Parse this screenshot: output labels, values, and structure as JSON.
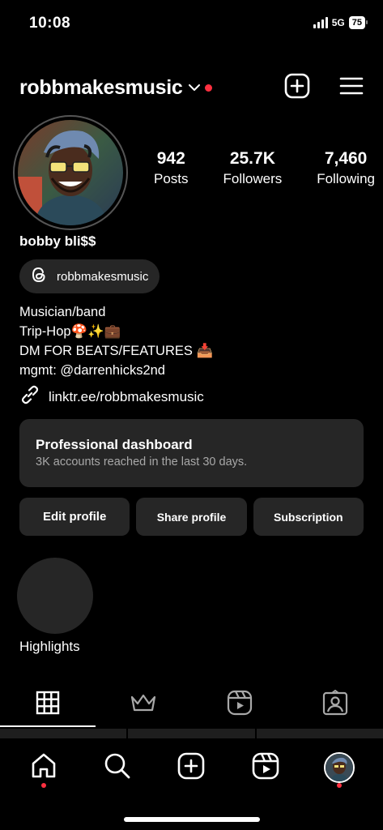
{
  "status": {
    "time": "10:08",
    "network": "5G",
    "battery": "75"
  },
  "header": {
    "username": "robbmakesmusic"
  },
  "stats": [
    {
      "value": "942",
      "label": "Posts"
    },
    {
      "value": "25.7K",
      "label": "Followers"
    },
    {
      "value": "7,460",
      "label": "Following"
    }
  ],
  "profile": {
    "display_name": "bobby bli$$",
    "threads_handle": "robbmakesmusic",
    "bio": [
      "Musician/band",
      "Trip-Hop🍄✨💼",
      "DM FOR BEATS/FEATURES 📥",
      "mgmt: @darrenhicks2nd"
    ],
    "link": "linktr.ee/robbmakesmusic"
  },
  "dashboard": {
    "title": "Professional dashboard",
    "subtitle": "3K accounts reached in the last 30 days."
  },
  "buttons": {
    "edit": "Edit profile",
    "share": "Share profile",
    "subscription": "Subscription"
  },
  "highlights": {
    "label": "Highlights"
  },
  "colors": {
    "accent_red": "#ff3040",
    "surface": "#262626",
    "background": "#000000"
  },
  "tabs": [
    "grid-icon",
    "crown-icon",
    "reels-icon",
    "tagged-icon"
  ],
  "nav": [
    "home-icon",
    "search-icon",
    "create-icon",
    "reels-icon",
    "profile-avatar"
  ]
}
